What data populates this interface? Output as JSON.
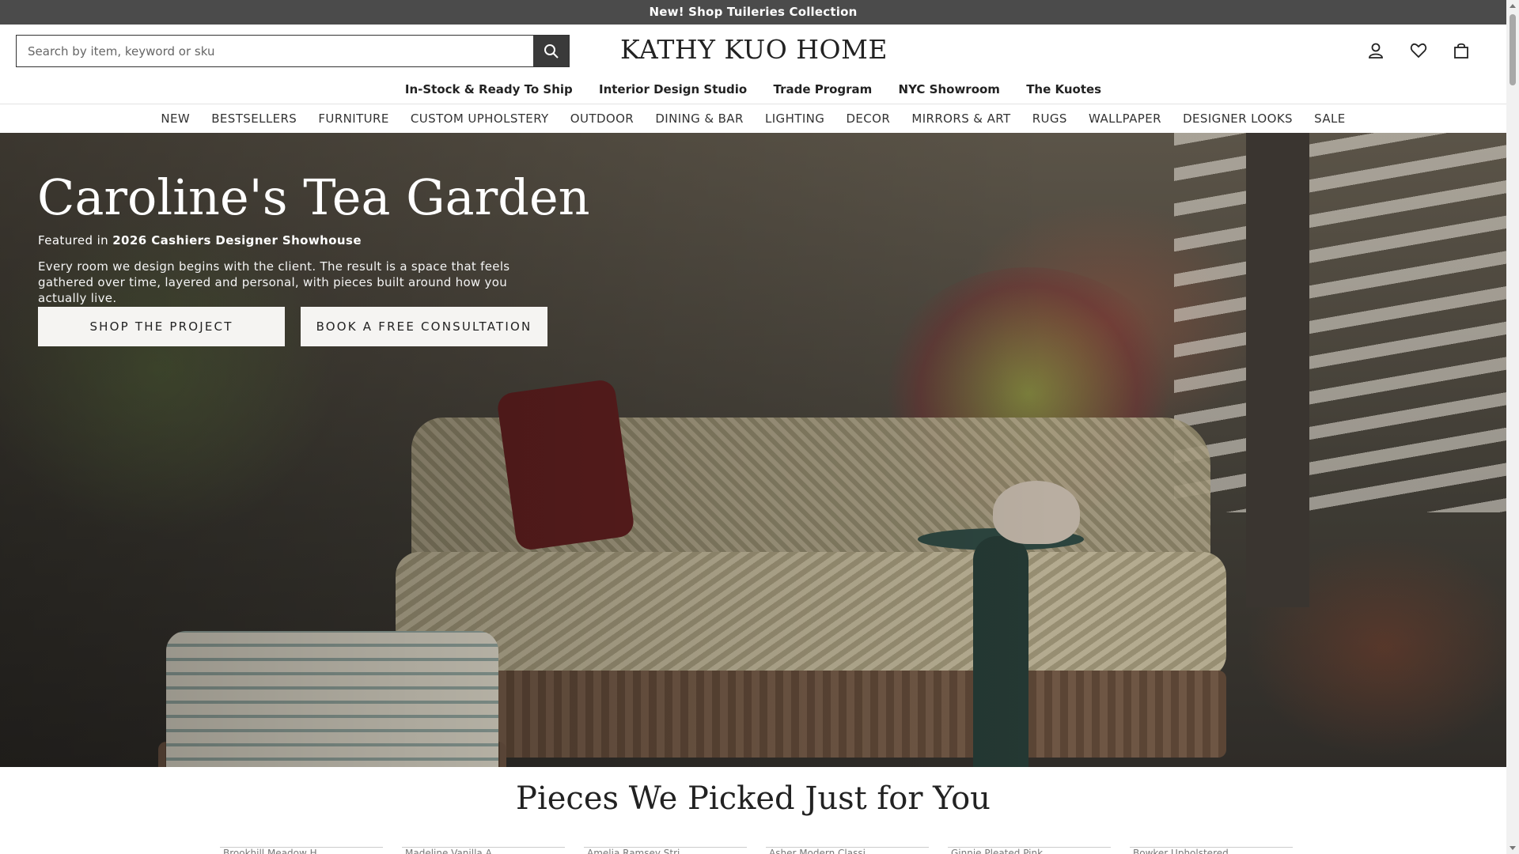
{
  "announcement": "New! Shop Tuileries Collection",
  "search": {
    "placeholder": "Search by item, keyword or sku"
  },
  "logo": "KATHY KUO HOME",
  "header_icons": [
    "user-icon",
    "heart-icon",
    "bag-icon"
  ],
  "subnav": [
    "In-Stock & Ready To Ship",
    "Interior Design Studio",
    "Trade Program",
    "NYC Showroom",
    "The Kuotes"
  ],
  "mainnav": [
    "NEW",
    "BESTSELLERS",
    "FURNITURE",
    "CUSTOM UPHOLSTERY",
    "OUTDOOR",
    "DINING & BAR",
    "LIGHTING",
    "DECOR",
    "MIRRORS & ART",
    "RUGS",
    "WALLPAPER",
    "DESIGNER LOOKS",
    "SALE"
  ],
  "hero": {
    "title": "Caroline's Tea Garden",
    "featured_prefix": "Featured in",
    "featured_name": "2026 Cashiers Designer Showhouse",
    "description": "Every room we design begins with the client. The result is a space that feels gathered over time, layered and personal, with pieces built around how you actually live.",
    "btn_shop": "SHOP THE PROJECT",
    "btn_book": "BOOK A FREE CONSULTATION"
  },
  "picks": {
    "title": "Pieces We Picked Just for You",
    "cards": [
      "Brookhill Meadow H",
      "Madeline Vanilla A",
      "Amelia Ramsey Stri",
      "Asher Modern Classi",
      "Ginnie Pleated Pink",
      "Bowker Upholstered"
    ]
  }
}
